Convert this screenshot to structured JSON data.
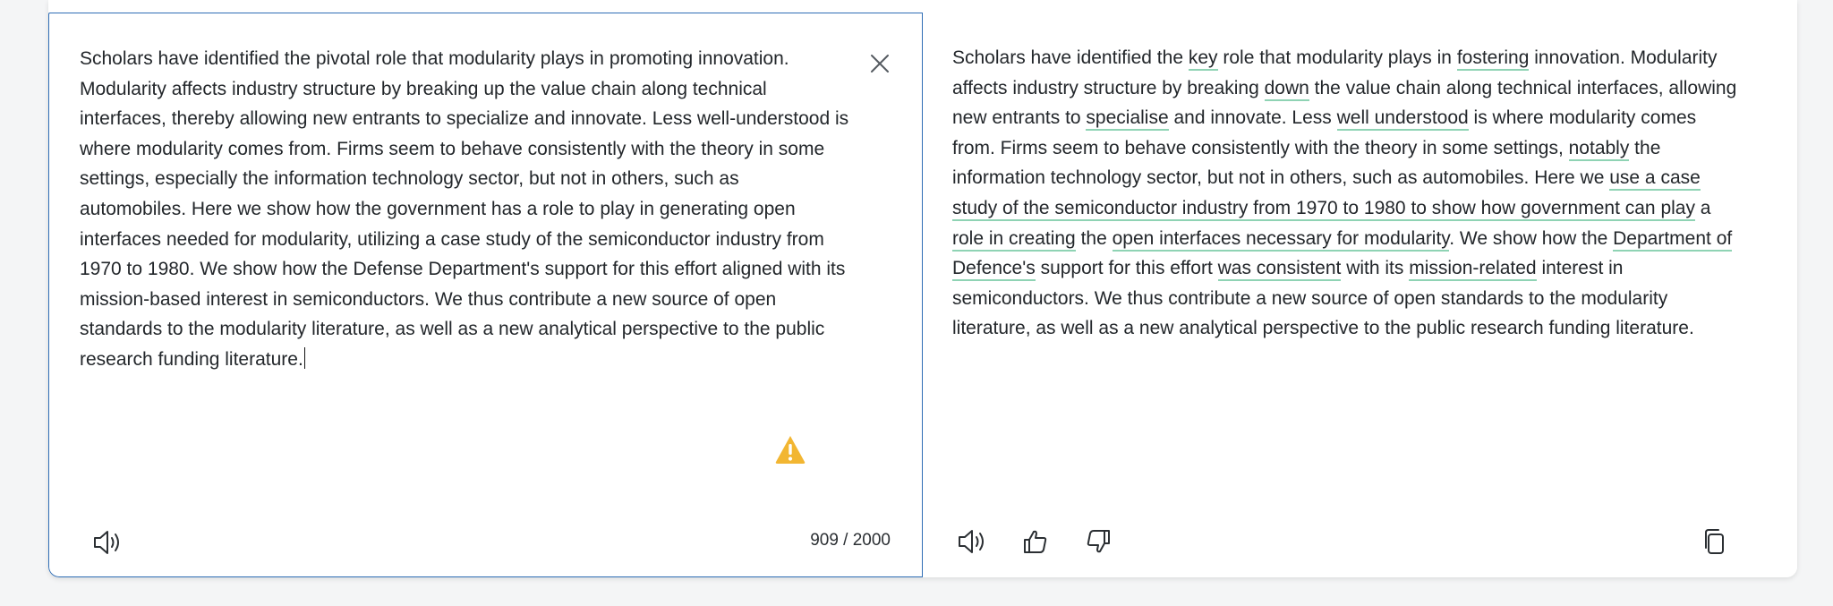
{
  "source": {
    "text": "Scholars have identified the pivotal role that modularity plays in promoting innovation. Modularity affects industry structure by breaking up the value chain along technical interfaces, thereby allowing new entrants to specialize and innovate. Less well-understood is where modularity comes from. Firms seem to behave consistently with the theory in some settings, especially the information technology sector, but not in others, such as automobiles. Here we show how the government has a role to play in generating open interfaces needed for modularity, utilizing a case study of the semiconductor industry from 1970 to 1980. We show how the Defense Department's support for this effort aligned with its mission-based interest in semiconductors. We thus contribute a new source of open standards to the modularity literature, as well as a new analytical perspective to the public research funding literature.",
    "char_count": "909 / 2000",
    "icons": {
      "close": "close-icon",
      "speaker": "speaker-icon",
      "warning": "warning-icon"
    }
  },
  "target": {
    "segments": [
      {
        "t": "Scholars have identified the ",
        "c": false
      },
      {
        "t": "key",
        "c": true
      },
      {
        "t": " role that modularity plays in ",
        "c": false
      },
      {
        "t": "fostering",
        "c": true
      },
      {
        "t": " innovation. Modularity affects industry structure by breaking ",
        "c": false
      },
      {
        "t": "down",
        "c": true
      },
      {
        "t": " the value chain along technical interfaces, allowing new entrants to ",
        "c": false
      },
      {
        "t": "specialise",
        "c": true
      },
      {
        "t": " and innovate. Less ",
        "c": false
      },
      {
        "t": "well understood",
        "c": true
      },
      {
        "t": " is where modularity comes from. Firms seem to behave consistently with the theory in some settings, ",
        "c": false
      },
      {
        "t": "notably",
        "c": true
      },
      {
        "t": " the information technology sector, but not in others, such as automobiles. Here we ",
        "c": false
      },
      {
        "t": "use a case study of the semiconductor industry from 1970 to 1980 to show how government can play",
        "c": true
      },
      {
        "t": " a ",
        "c": false
      },
      {
        "t": "role in creating",
        "c": true
      },
      {
        "t": " the ",
        "c": false
      },
      {
        "t": "open interfaces necessary for modularity",
        "c": true
      },
      {
        "t": ". We show how the ",
        "c": false
      },
      {
        "t": "Department of Defence's",
        "c": true
      },
      {
        "t": " support for this effort ",
        "c": false
      },
      {
        "t": "was consistent",
        "c": true
      },
      {
        "t": " with its ",
        "c": false
      },
      {
        "t": "mission-related",
        "c": true
      },
      {
        "t": " interest in semiconductors. We thus contribute a new source of open standards to the modularity literature, as well as a new analytical perspective to the public research funding literature.",
        "c": false
      }
    ],
    "icons": {
      "speaker": "speaker-icon",
      "thumbs_up": "thumbs-up-icon",
      "thumbs_down": "thumbs-down-icon",
      "copy": "copy-icon"
    }
  },
  "colors": {
    "focus_border": "#2f6db5",
    "change_underline": "#8fd3b4",
    "warning": "#f2b632"
  }
}
